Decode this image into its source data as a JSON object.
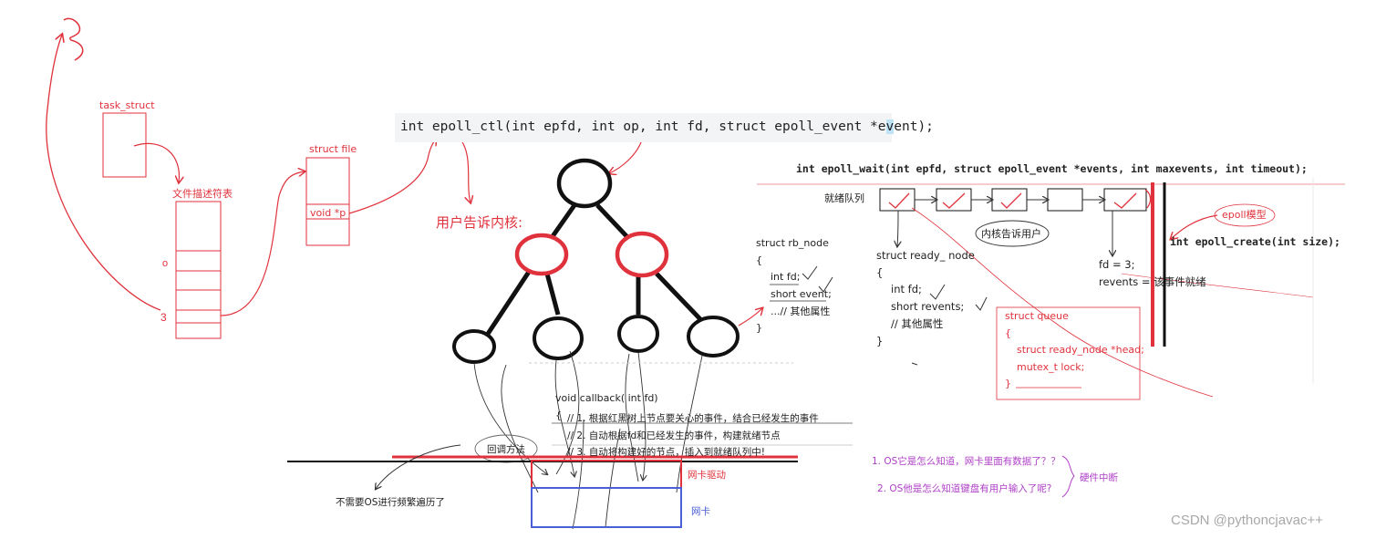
{
  "labels": {
    "task_struct": "task_struct",
    "fd_table": "文件描述符表",
    "struct_file": "struct file",
    "void_p": "void *p",
    "user_tells_kernel": "用户告诉内核:",
    "epoll_ctl_sig_a": "int epoll_ctl(int epfd, int op, int fd, struct epoll_event *e",
    "epoll_ctl_sig_hl": "v",
    "epoll_ctl_sig_b": "ent);",
    "epoll_wait_sig": "int epoll_wait(int epfd, struct epoll_event *events, int maxevents, int timeout);",
    "ready_queue": "就绪队列",
    "kernel_tells_user": "内核告诉用户",
    "epoll_model": "epoll模型",
    "epoll_create_sig": "int epoll_create(int size);",
    "fd_3": "fd = 3;",
    "revents_ready": "revents = 该事件就绪",
    "hw_interrupt": "硬件中断",
    "q1": "1. OS它是怎么知道，网卡里面有数据了？？",
    "q2": "2. OS他是怎么知道键盘有用户输入了呢?",
    "callback_method": "回调方法",
    "no_traverse": "不需要OS进行频繁遍历了",
    "nic_driver": "网卡驱动",
    "nic": "网卡",
    "watermark": "CSDN @pythoncjavac++"
  },
  "rb_node": [
    "struct rb_node",
    "{",
    "int fd;",
    "short event;",
    "...// 其他属性",
    "}"
  ],
  "ready_node": [
    "struct ready_ node",
    "{",
    "int fd;",
    "short revents;",
    "// 其他属性",
    "}"
  ],
  "queue": [
    "struct queue",
    "{",
    "struct ready_node *head;",
    "mutex_t  lock;",
    "}"
  ],
  "callback": [
    "void callback( int fd)",
    "{",
    "// 1. 根据红黑树上节点要关心的事件，结合已经发生的事件",
    "// 2. 自动根据fd和已经发生的事件，构建就绪节点",
    "// 3. 自动将构建好的节点，插入到就绪队列中!"
  ],
  "colors": {
    "red": "#e0323c",
    "black": "#111111",
    "blue": "#4b5fd6",
    "purple": "#b040c8",
    "gray": "#444444"
  }
}
